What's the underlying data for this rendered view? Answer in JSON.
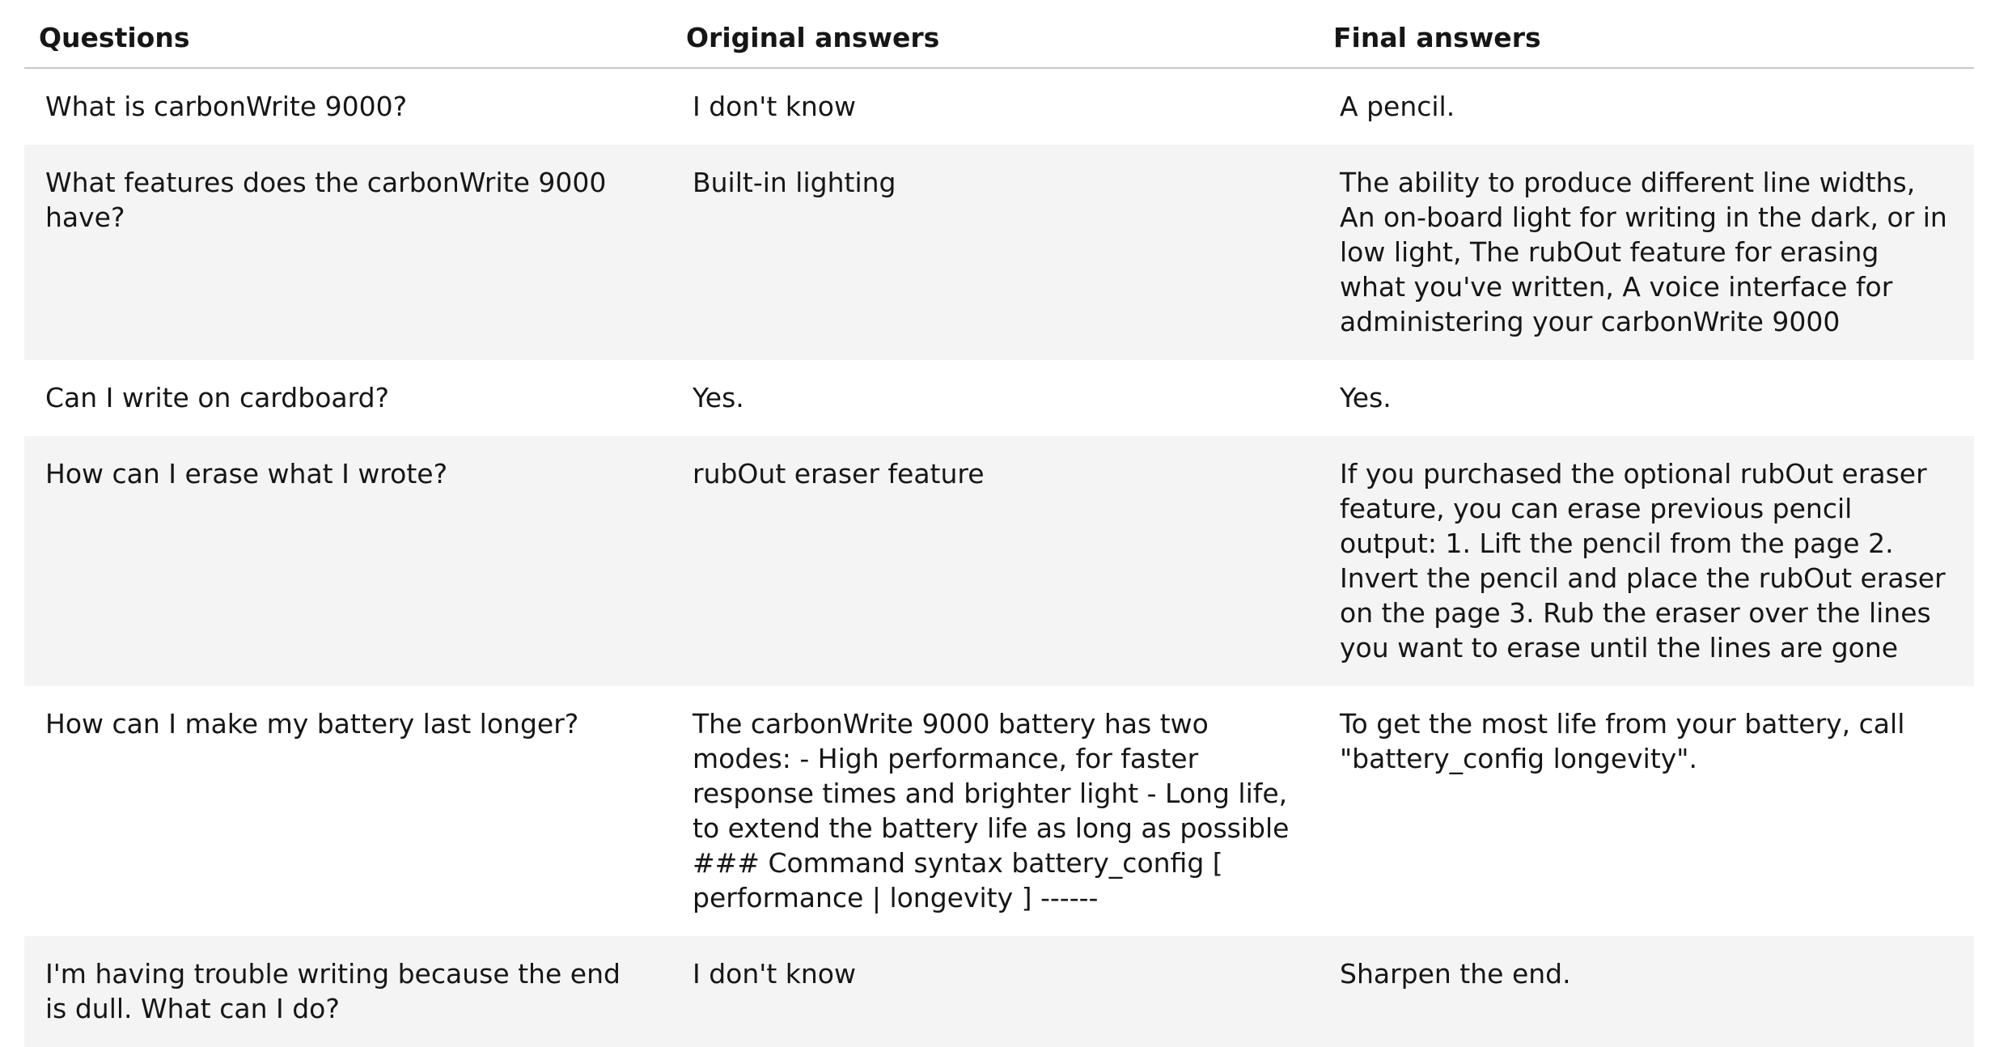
{
  "table": {
    "headers": [
      "Questions",
      "Original answers",
      "Final answers"
    ],
    "rows": [
      {
        "question": "What is carbonWrite 9000?",
        "original": "I don't know",
        "final": "A pencil."
      },
      {
        "question": "What features does the carbonWrite 9000 have?",
        "original": "Built-in lighting",
        "final": "The ability to produce different line widths, An on-board light for writing in the dark, or in low light, The rubOut feature for erasing what you've written, A voice interface for administering your carbonWrite 9000"
      },
      {
        "question": "Can I write on cardboard?",
        "original": "Yes.",
        "final": "Yes."
      },
      {
        "question": "How can I erase what I wrote?",
        "original": "rubOut eraser feature",
        "final": "If you purchased the optional rubOut eraser feature, you can erase previous pencil output: 1. Lift the pencil from the page 2. Invert the pencil and place the rubOut eraser on the page 3. Rub the eraser over the lines you want to erase until the lines are gone"
      },
      {
        "question": "How can I make my battery last longer?",
        "original": "The carbonWrite 9000 battery has two modes: - High performance, for faster response times and brighter light - Long life, to extend the battery life as long as possible ### Command syntax battery_config [ performance | longevity ] ------",
        "final": "To get the most life from your battery, call \"battery_config longevity\"."
      },
      {
        "question": "I'm having trouble writing because the end is dull. What can I do?",
        "original": "I don't know",
        "final": "Sharpen the end."
      }
    ]
  }
}
